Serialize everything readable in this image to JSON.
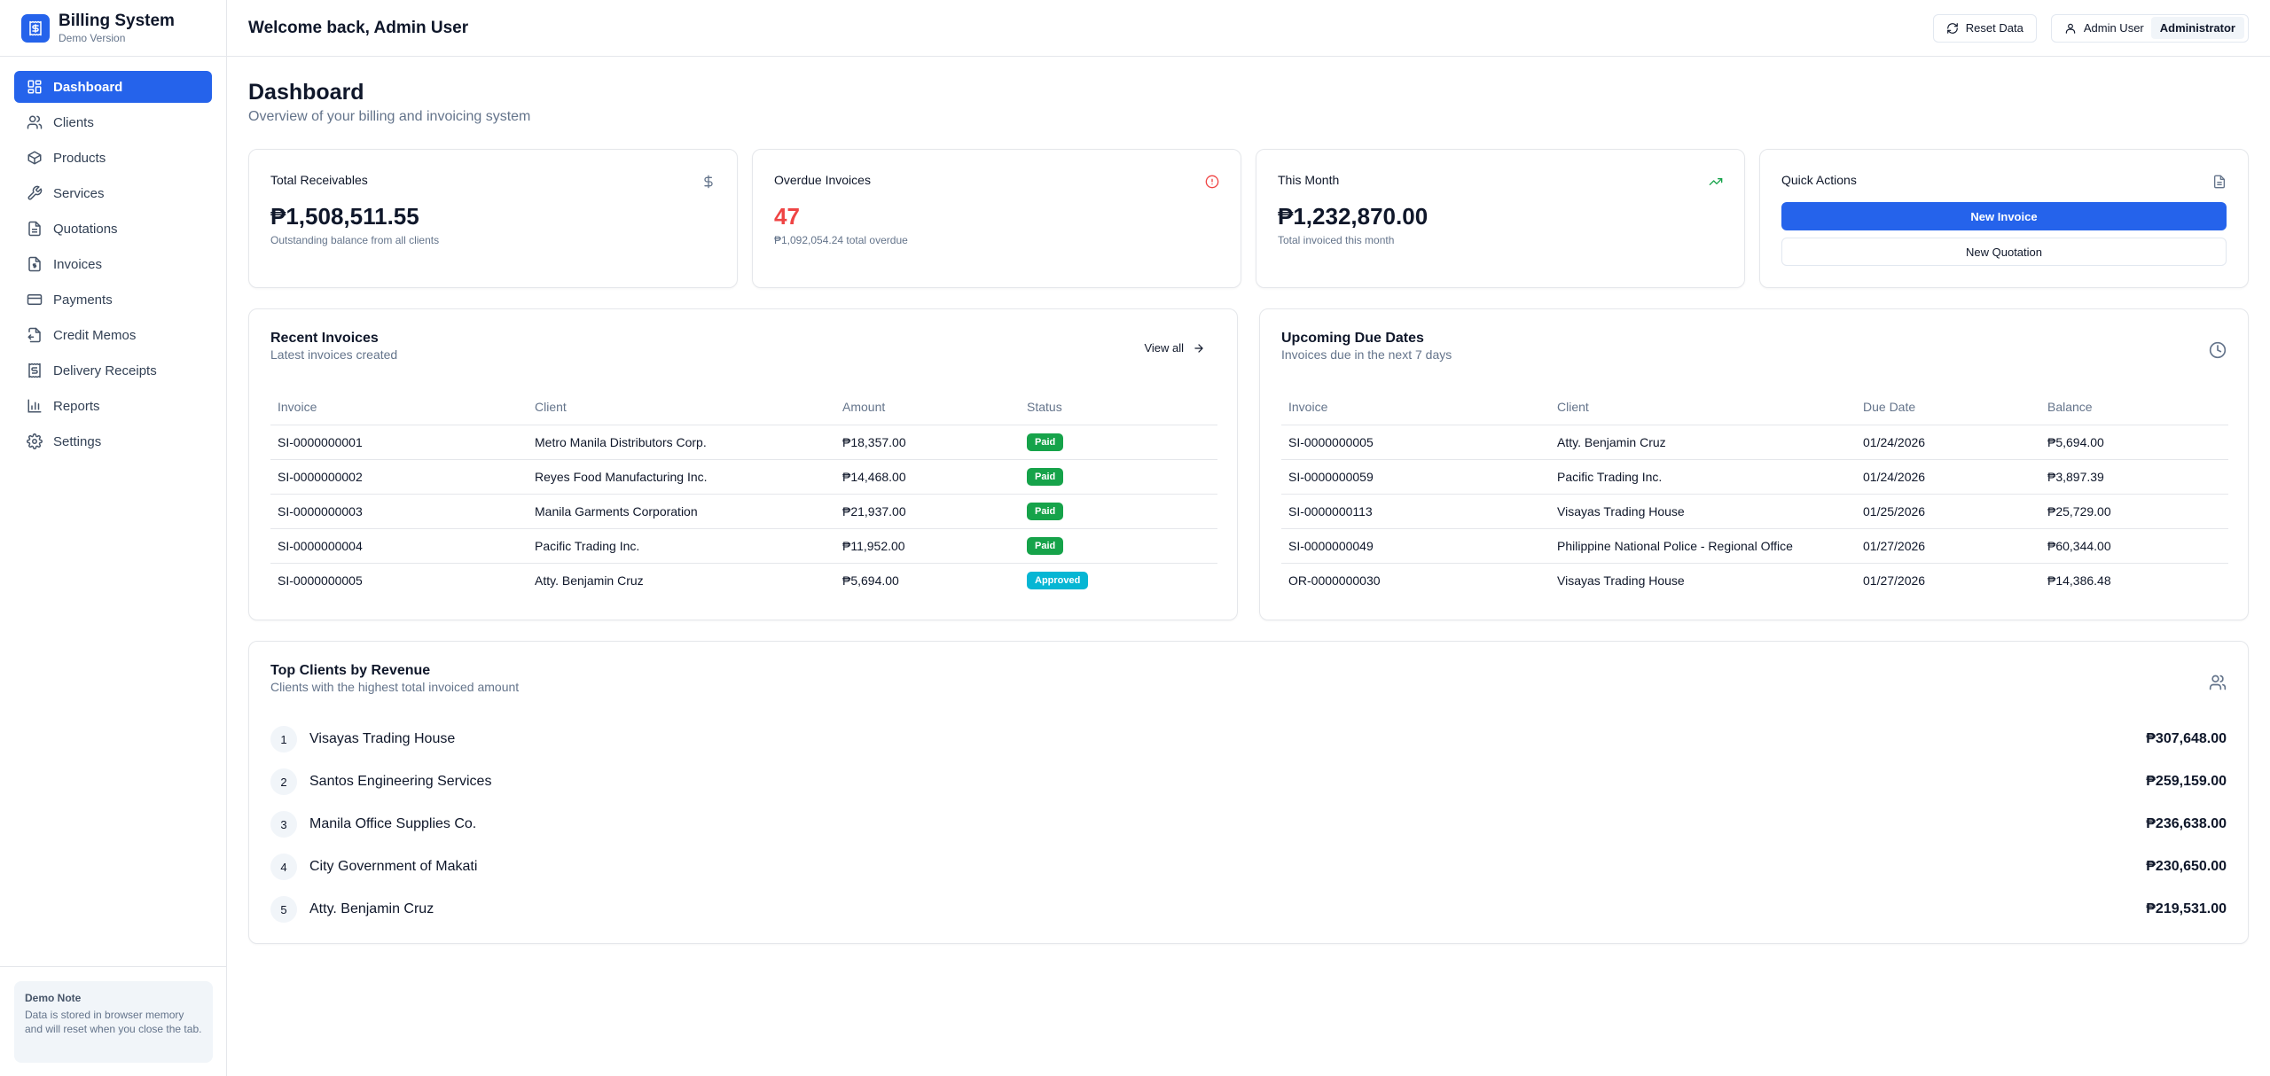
{
  "brand": {
    "title": "Billing System",
    "subtitle": "Demo Version"
  },
  "sidebar": {
    "items": [
      {
        "label": "Dashboard",
        "icon": "dashboard-icon"
      },
      {
        "label": "Clients",
        "icon": "users-icon"
      },
      {
        "label": "Products",
        "icon": "package-icon"
      },
      {
        "label": "Services",
        "icon": "wrench-icon"
      },
      {
        "label": "Quotations",
        "icon": "file-text-icon"
      },
      {
        "label": "Invoices",
        "icon": "file-dollar-icon"
      },
      {
        "label": "Payments",
        "icon": "credit-card-icon"
      },
      {
        "label": "Credit Memos",
        "icon": "file-return-icon"
      },
      {
        "label": "Delivery Receipts",
        "icon": "receipt-icon"
      },
      {
        "label": "Reports",
        "icon": "bar-chart-icon"
      },
      {
        "label": "Settings",
        "icon": "gear-icon"
      }
    ],
    "note": {
      "title": "Demo Note",
      "text": "Data is stored in browser memory and will reset when you close the tab."
    }
  },
  "header": {
    "welcome": "Welcome back, Admin User",
    "reset_label": "Reset Data",
    "user_name": "Admin User",
    "role": "Administrator"
  },
  "page": {
    "title": "Dashboard",
    "subtitle": "Overview of your billing and invoicing system"
  },
  "stats": {
    "receivables": {
      "label": "Total Receivables",
      "value": "₱1,508,511.55",
      "desc": "Outstanding balance from all clients"
    },
    "overdue": {
      "label": "Overdue Invoices",
      "value": "47",
      "desc": "₱1,092,054.24 total overdue"
    },
    "month": {
      "label": "This Month",
      "value": "₱1,232,870.00",
      "desc": "Total invoiced this month"
    },
    "quick": {
      "label": "Quick Actions",
      "new_invoice": "New Invoice",
      "new_quotation": "New Quotation"
    }
  },
  "recent": {
    "title": "Recent Invoices",
    "subtitle": "Latest invoices created",
    "view_all": "View all",
    "columns": [
      "Invoice",
      "Client",
      "Amount",
      "Status"
    ],
    "rows": [
      {
        "invoice": "SI-0000000001",
        "client": "Metro Manila Distributors Corp.",
        "amount": "₱18,357.00",
        "status": "Paid"
      },
      {
        "invoice": "SI-0000000002",
        "client": "Reyes Food Manufacturing Inc.",
        "amount": "₱14,468.00",
        "status": "Paid"
      },
      {
        "invoice": "SI-0000000003",
        "client": "Manila Garments Corporation",
        "amount": "₱21,937.00",
        "status": "Paid"
      },
      {
        "invoice": "SI-0000000004",
        "client": "Pacific Trading Inc.",
        "amount": "₱11,952.00",
        "status": "Paid"
      },
      {
        "invoice": "SI-0000000005",
        "client": "Atty. Benjamin Cruz",
        "amount": "₱5,694.00",
        "status": "Approved"
      }
    ]
  },
  "upcoming": {
    "title": "Upcoming Due Dates",
    "subtitle": "Invoices due in the next 7 days",
    "columns": [
      "Invoice",
      "Client",
      "Due Date",
      "Balance"
    ],
    "rows": [
      {
        "invoice": "SI-0000000005",
        "client": "Atty. Benjamin Cruz",
        "due": "01/24/2026",
        "balance": "₱5,694.00"
      },
      {
        "invoice": "SI-0000000059",
        "client": "Pacific Trading Inc.",
        "due": "01/24/2026",
        "balance": "₱3,897.39"
      },
      {
        "invoice": "SI-0000000113",
        "client": "Visayas Trading House",
        "due": "01/25/2026",
        "balance": "₱25,729.00"
      },
      {
        "invoice": "SI-0000000049",
        "client": "Philippine National Police - Regional Office",
        "due": "01/27/2026",
        "balance": "₱60,344.00"
      },
      {
        "invoice": "OR-0000000030",
        "client": "Visayas Trading House",
        "due": "01/27/2026",
        "balance": "₱14,386.48"
      }
    ]
  },
  "top_clients": {
    "title": "Top Clients by Revenue",
    "subtitle": "Clients with the highest total invoiced amount",
    "items": [
      {
        "rank": "1",
        "name": "Visayas Trading House",
        "amount": "₱307,648.00"
      },
      {
        "rank": "2",
        "name": "Santos Engineering Services",
        "amount": "₱259,159.00"
      },
      {
        "rank": "3",
        "name": "Manila Office Supplies Co.",
        "amount": "₱236,638.00"
      },
      {
        "rank": "4",
        "name": "City Government of Makati",
        "amount": "₱230,650.00"
      },
      {
        "rank": "5",
        "name": "Atty. Benjamin Cruz",
        "amount": "₱219,531.00"
      }
    ]
  },
  "colors": {
    "primary": "#2563eb",
    "paid": "#16a34a",
    "approved": "#06b6d4",
    "danger": "#ef4444",
    "success": "#16a34a"
  }
}
